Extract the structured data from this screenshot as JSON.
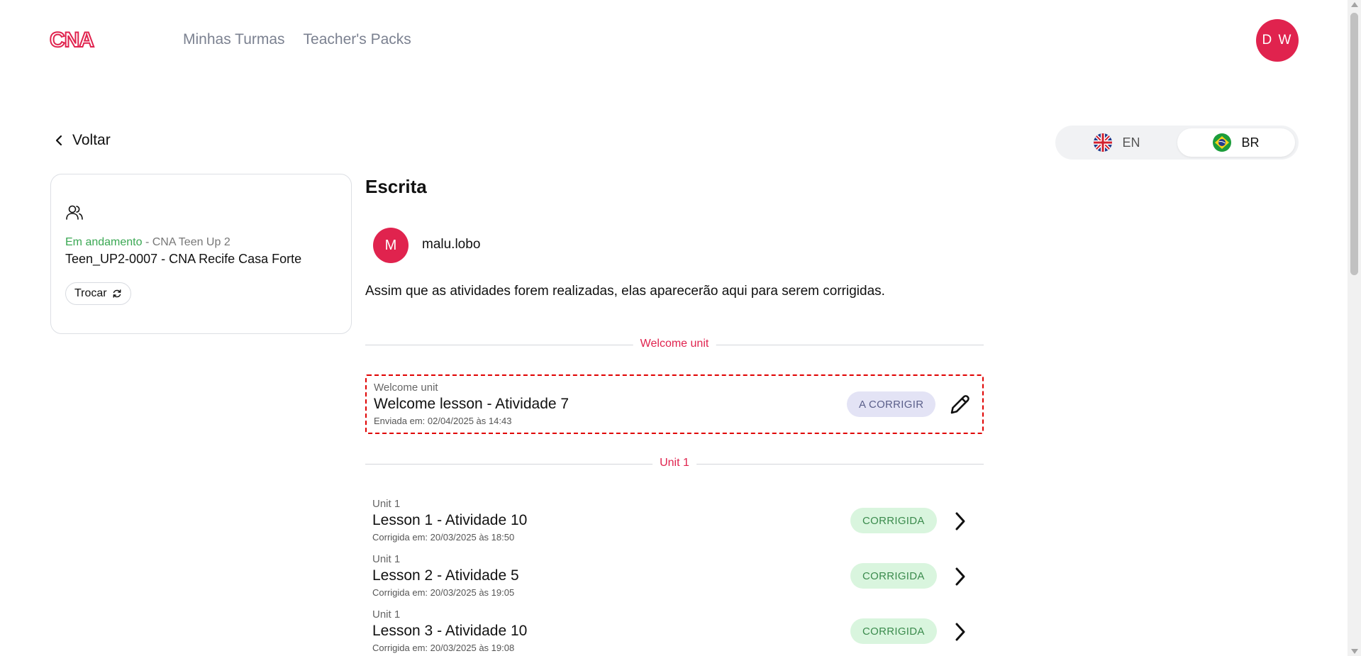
{
  "header": {
    "logo_text": "CNA",
    "nav": [
      "Minhas Turmas",
      "Teacher's Packs"
    ],
    "user_initials": "D W"
  },
  "back_label": "Voltar",
  "language": {
    "options": [
      {
        "code": "EN",
        "icon": "uk-flag-icon"
      },
      {
        "code": "BR",
        "icon": "brazil-flag-icon"
      }
    ],
    "selected": "BR"
  },
  "class_card": {
    "status": "Em andamento",
    "separator": " - ",
    "course": "CNA Teen Up 2",
    "name": "Teen_UP2-0007 - CNA Recife Casa Forte",
    "switch_label": "Trocar"
  },
  "main": {
    "title": "Escrita",
    "student": {
      "initial": "M",
      "username": "malu.lobo"
    },
    "info": "Assim que as atividades forem realizadas, elas aparecerão aqui para serem corrigidas."
  },
  "groups": [
    {
      "label": "Welcome unit",
      "activities": [
        {
          "unit": "Welcome unit",
          "title": "Welcome lesson - Atividade 7",
          "date": "Enviada em: 02/04/2025 às 14:43",
          "status": "A CORRIGIR",
          "action_icon": "pencil-icon"
        }
      ]
    },
    {
      "label": "Unit 1",
      "activities": [
        {
          "unit": "Unit 1",
          "title": "Lesson 1 - Atividade 10",
          "date": "Corrigida em: 20/03/2025 às 18:50",
          "status": "CORRIGIDA",
          "action_icon": "chevron-right-icon"
        },
        {
          "unit": "Unit 1",
          "title": "Lesson 2 - Atividade 5",
          "date": "Corrigida em: 20/03/2025 às 19:05",
          "status": "CORRIGIDA",
          "action_icon": "chevron-right-icon"
        },
        {
          "unit": "Unit 1",
          "title": "Lesson 3 - Atividade 10",
          "date": "Corrigida em: 20/03/2025 às 19:08",
          "status": "CORRIGIDA",
          "action_icon": "chevron-right-icon"
        }
      ]
    }
  ],
  "colors": {
    "brand": "#e0234e",
    "success": "#3aa853",
    "highlight": "#e00000"
  }
}
